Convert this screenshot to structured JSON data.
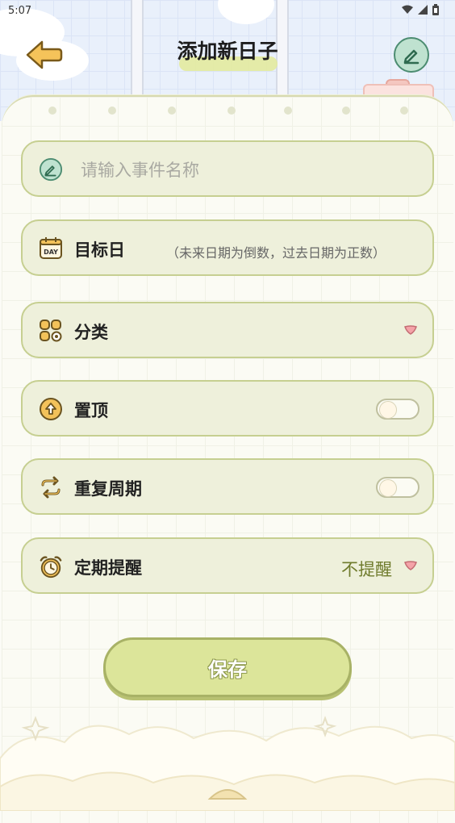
{
  "status_bar": {
    "time": "5:07",
    "icons": [
      "wifi-icon",
      "signal-icon",
      "battery-icon"
    ]
  },
  "header": {
    "title": "添加新日子",
    "back_icon": "arrow-left-icon",
    "edit_icon": "pencil-icon"
  },
  "form": {
    "name_field": {
      "placeholder": "请输入事件名称",
      "value": "",
      "icon": "pencil-icon"
    },
    "target_date": {
      "label": "目标日",
      "hint": "（未来日期为倒数，过去日期为正数）",
      "icon": "calendar-day-icon",
      "icon_text": "DAY"
    },
    "category": {
      "label": "分类",
      "icon": "category-grid-icon"
    },
    "pin_top": {
      "label": "置顶",
      "icon": "pin-top-icon",
      "enabled": false
    },
    "repeat": {
      "label": "重复周期",
      "icon": "repeat-icon",
      "enabled": false
    },
    "reminder": {
      "label": "定期提醒",
      "icon": "alarm-clock-icon",
      "value": "不提醒"
    }
  },
  "save_button": {
    "label": "保存"
  },
  "colors": {
    "row_bg": "#eef0db",
    "row_border": "#c6cf91",
    "accent_green": "#6f7b2c",
    "save_bg": "#dce59a",
    "chevron_pink": "#f4a3a8"
  }
}
